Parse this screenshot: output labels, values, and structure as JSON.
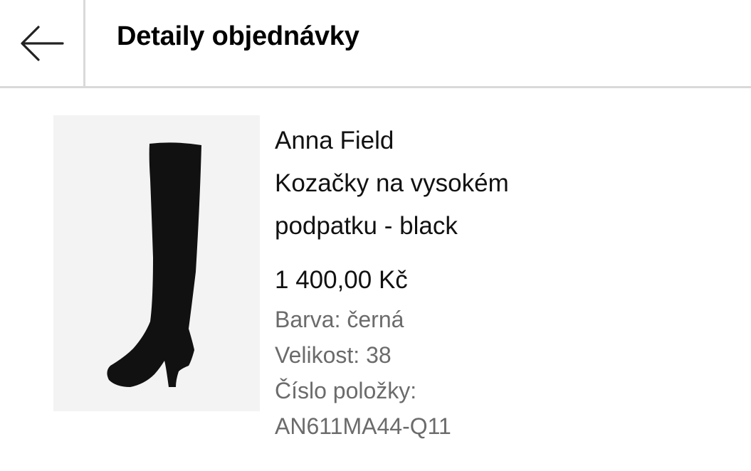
{
  "header": {
    "title": "Detaily objednávky"
  },
  "product": {
    "brand": "Anna Field",
    "name": "Kozačky na vysokém podpatku - black",
    "price": "1 400,00 Kč",
    "color": "Barva: černá",
    "size": "Velikost: 38",
    "item_number_label": "Číslo položky:",
    "item_number": "AN611MA44-Q11"
  },
  "colors": {
    "divider": "#d9d9d9",
    "image_bg": "#f3f3f3",
    "secondary_text": "#6b6b6b",
    "boot": "#111111"
  },
  "icons": {
    "back": "arrow-left-icon",
    "product": "boot-image"
  }
}
